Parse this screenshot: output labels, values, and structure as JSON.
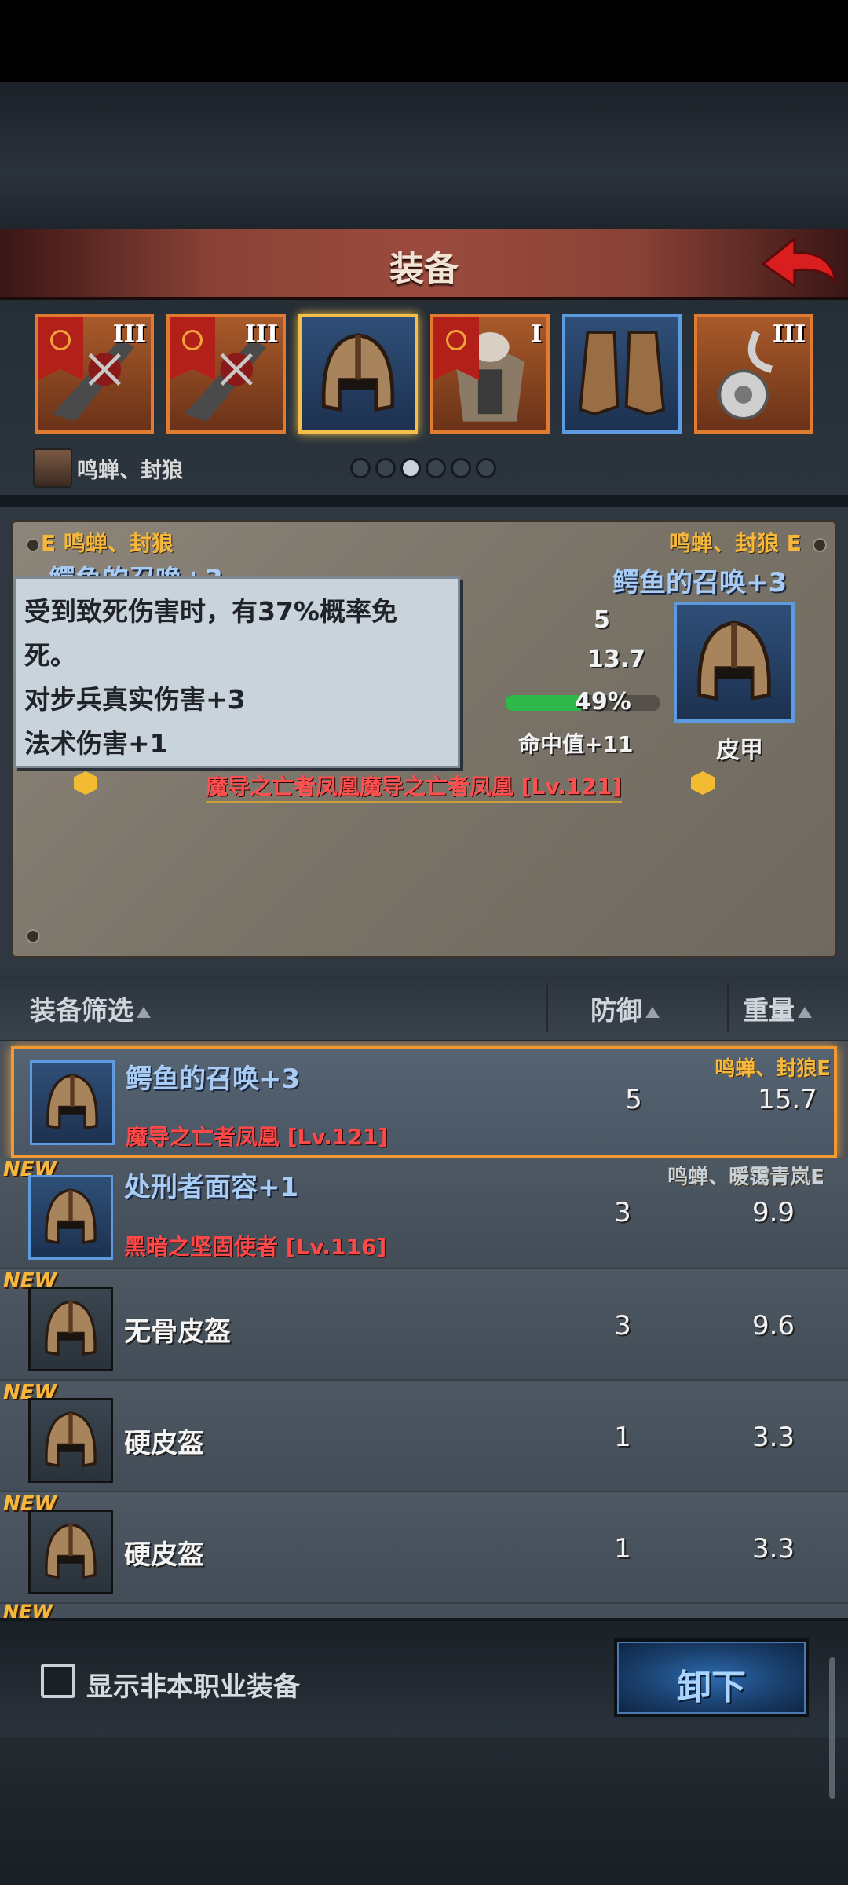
{
  "title": "装备",
  "slots": [
    {
      "icon": "demon-sword-icon",
      "level": "III",
      "banner": true
    },
    {
      "icon": "demon-sword-icon",
      "level": "III",
      "banner": true
    },
    {
      "icon": "leather-helmet-icon",
      "level": "",
      "banner": false,
      "selected": true
    },
    {
      "icon": "fur-armor-icon",
      "level": "I",
      "banner": true
    },
    {
      "icon": "leather-boots-icon",
      "level": "",
      "banner": false
    },
    {
      "icon": "silver-amulet-icon",
      "level": "III",
      "banner": false
    }
  ],
  "owner": {
    "name": "鸣蝉、封狼"
  },
  "page_dots": {
    "count": 6,
    "active": 2
  },
  "compare": {
    "left_owner": "E 鸣蝉、封狼",
    "left_item_partial": "鳄鱼的召唤+3",
    "right_owner": "鸣蝉、封狼 E",
    "right_item": "鳄鱼的召唤+3",
    "stat_defense": "5",
    "stat_weight": "13.7",
    "stat_percent": "49%",
    "stat_percent_value": 0.49,
    "stat_hit": "命中值+11",
    "set_name": "魔导之亡者凤凰魔导之亡者凤凰 [Lv.121]",
    "type_label": "皮甲"
  },
  "tooltip": {
    "line1": "受到致死伤害时，有37%概率免",
    "line2": "死。",
    "line3": "对步兵真实伤害+3",
    "line4": "法术伤害+1"
  },
  "header": {
    "filter": "装备筛选",
    "defense": "防御",
    "weight": "重量"
  },
  "rows": [
    {
      "name": "鳄鱼的召唤+3",
      "sub": "魔导之亡者凤凰 [Lv.121]",
      "owner": "鸣蝉、封狼E",
      "defense": "5",
      "weight": "15.7",
      "new": "",
      "selected": true,
      "color": "blue"
    },
    {
      "name": "处刑者面容+1",
      "sub": "黑暗之坚固使者 [Lv.116]",
      "owner": "鸣蝉、暖霭青岚E",
      "defense": "3",
      "weight": "9.9",
      "new": "NEW",
      "selected": false,
      "color": "blue"
    },
    {
      "name": "无骨皮盔",
      "sub": "",
      "owner": "",
      "defense": "3",
      "weight": "9.6",
      "new": "NEW",
      "selected": false,
      "color": "white"
    },
    {
      "name": "硬皮盔",
      "sub": "",
      "owner": "",
      "defense": "1",
      "weight": "3.3",
      "new": "NEW",
      "selected": false,
      "color": "white"
    },
    {
      "name": "硬皮盔",
      "sub": "",
      "owner": "",
      "defense": "1",
      "weight": "3.3",
      "new": "NEW",
      "selected": false,
      "color": "white"
    }
  ],
  "partial_new": "NEW",
  "footer": {
    "checkbox_label": "显示非本职业装备",
    "unequip_label": "卸下"
  },
  "colors": {
    "accent_gold": "#f6b83c",
    "selected_orange": "#f09a30",
    "blue_border": "#5e9ae0",
    "red_text": "#ff4848"
  }
}
